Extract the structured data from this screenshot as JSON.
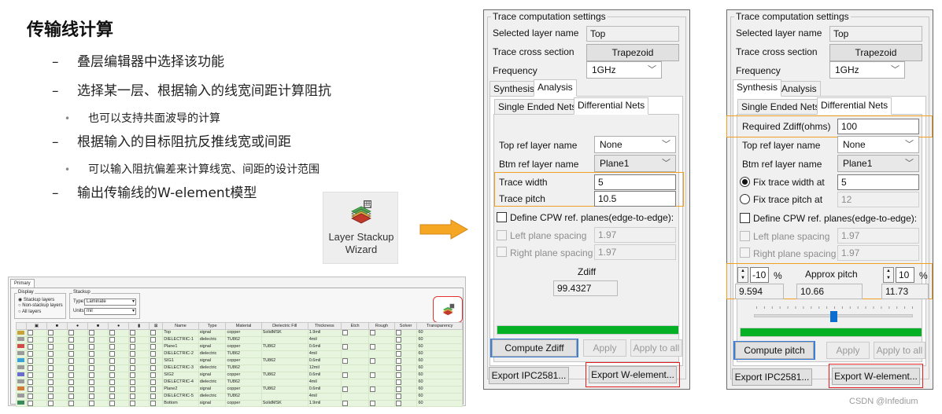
{
  "slide": {
    "title": "传输线计算",
    "bullets": [
      {
        "level": 1,
        "text": "叠层编辑器中选择该功能"
      },
      {
        "level": 1,
        "text": "选择某一层、根据输入的线宽间距计算阻抗"
      },
      {
        "level": 2,
        "text": "也可以支持共面波导的计算"
      },
      {
        "level": 1,
        "text": "根据输入的目标阻抗反推线宽或间距"
      },
      {
        "level": 2,
        "text": "可以输入阻抗偏差来计算线宽、间距的设计范围"
      },
      {
        "level": 1,
        "text": "输出传输线的W-element模型"
      }
    ],
    "wizard": {
      "icon": "layer-stackup-wizard-icon",
      "line1": "Layer Stackup",
      "line2": "Wizard"
    },
    "arrow_color": "#f5a623"
  },
  "stackup": {
    "tab": "Primary",
    "display": {
      "title": "Display",
      "options": [
        "Stackup layers",
        "Non-stackup layers",
        "All layers"
      ],
      "selected": 0
    },
    "stackup_group": {
      "title": "Stackup",
      "type_label": "Type:",
      "type_value": "Laminate",
      "units_label": "Units:",
      "units_value": "mil"
    },
    "columns": [
      "Name",
      "Type",
      "Material",
      "Dielectric Fill",
      "Thickness",
      "Etch",
      "Rough",
      "Solver",
      "Transparency"
    ],
    "rows": [
      {
        "name": "Top",
        "type": "signal",
        "material": "copper",
        "fill": "SolidMSK",
        "thickness": "1.9mil",
        "color": "#c9a13b"
      },
      {
        "name": "DIELECTRIC-1",
        "type": "dielectric",
        "material": "TU862",
        "fill": "",
        "thickness": "4mil",
        "color": "#9a9a9a"
      },
      {
        "name": "Plane1",
        "type": "signal",
        "material": "copper",
        "fill": "TU862",
        "thickness": "0.6mil",
        "color": "#d24a4a"
      },
      {
        "name": "DIELECTRIC-2",
        "type": "dielectric",
        "material": "TU862",
        "fill": "",
        "thickness": "4mil",
        "color": "#9a9a9a"
      },
      {
        "name": "SIG1",
        "type": "signal",
        "material": "copper",
        "fill": "TU862",
        "thickness": "0.6mil",
        "color": "#3aa0d8"
      },
      {
        "name": "DIELECTRIC-3",
        "type": "dielectric",
        "material": "TU862",
        "fill": "",
        "thickness": "12mil",
        "color": "#9a9a9a"
      },
      {
        "name": "SIG2",
        "type": "signal",
        "material": "copper",
        "fill": "TU862",
        "thickness": "0.6mil",
        "color": "#6a6ad0"
      },
      {
        "name": "DIELECTRIC-4",
        "type": "dielectric",
        "material": "TU862",
        "fill": "",
        "thickness": "4mil",
        "color": "#9a9a9a"
      },
      {
        "name": "Plane2",
        "type": "signal",
        "material": "copper",
        "fill": "TU862",
        "thickness": "0.6mil",
        "color": "#d27a3a"
      },
      {
        "name": "DIELECTRIC-5",
        "type": "dielectric",
        "material": "TU862",
        "fill": "",
        "thickness": "4mil",
        "color": "#9a9a9a"
      },
      {
        "name": "Bottom",
        "type": "signal",
        "material": "copper",
        "fill": "SolidMSK",
        "thickness": "1.9mil",
        "color": "#3a8a5a"
      }
    ],
    "transparency_value": "60"
  },
  "left_dialog": {
    "group_title": "Trace computation settings",
    "selected_layer_label": "Selected layer name",
    "selected_layer_value": "Top",
    "cross_section_label": "Trace cross section",
    "cross_section_value": "Trapezoid",
    "frequency_label": "Frequency",
    "frequency_value": "1GHz",
    "tabs": [
      "Synthesis",
      "Analysis"
    ],
    "active_tab": "Analysis",
    "subtabs": [
      "Single Ended Nets",
      "Differential Nets"
    ],
    "active_subtab": "Differential Nets",
    "top_ref_label": "Top ref layer name",
    "top_ref_value": "None",
    "btm_ref_label": "Btm ref layer name",
    "btm_ref_value": "Plane1",
    "trace_width_label": "Trace width",
    "trace_width_value": "5",
    "trace_pitch_label": "Trace pitch",
    "trace_pitch_value": "10.5",
    "cpw_label": "Define CPW ref. planes(edge-to-edge):",
    "left_spacing_label": "Left plane spacing",
    "left_spacing_value": "1.97",
    "right_spacing_label": "Right plane spacing",
    "right_spacing_value": "1.97",
    "zdiff_label": "Zdiff",
    "zdiff_value": "99.4327",
    "progress": 1.0,
    "compute_label": "Compute Zdiff",
    "apply_label": "Apply",
    "apply_all_label": "Apply to all",
    "export_ipc_label": "Export IPC2581...",
    "export_w_label": "Export W-element..."
  },
  "right_dialog": {
    "group_title": "Trace computation settings",
    "selected_layer_label": "Selected layer name",
    "selected_layer_value": "Top",
    "cross_section_label": "Trace cross section",
    "cross_section_value": "Trapezoid",
    "frequency_label": "Frequency",
    "frequency_value": "1GHz",
    "tabs": [
      "Synthesis",
      "Analysis"
    ],
    "active_tab": "Synthesis",
    "subtabs": [
      "Single Ended Nets",
      "Differential Nets"
    ],
    "active_subtab": "Differential Nets",
    "required_zdiff_label": "Required Zdiff(ohms)",
    "required_zdiff_value": "100",
    "top_ref_label": "Top ref layer name",
    "top_ref_value": "None",
    "btm_ref_label": "Btm ref layer name",
    "btm_ref_value": "Plane1",
    "fix_width_label": "Fix trace width at",
    "fix_width_value": "5",
    "fix_pitch_label": "Fix trace pitch at",
    "fix_pitch_value": "12",
    "cpw_label": "Define CPW ref. planes(edge-to-edge):",
    "left_spacing_label": "Left plane spacing",
    "left_spacing_value": "1.97",
    "right_spacing_label": "Right plane spacing",
    "right_spacing_value": "1.97",
    "tol_low_value": "-10",
    "tol_high_value": "10",
    "percent": "%",
    "approx_label": "Approx pitch",
    "approx_min": "9.594",
    "approx_mid": "10.66",
    "approx_max": "11.73",
    "slider_level": 0.5,
    "progress": 1.0,
    "compute_label": "Compute pitch",
    "apply_label": "Apply",
    "apply_all_label": "Apply to all",
    "export_ipc_label": "Export IPC2581...",
    "export_w_label": "Export W-element..."
  },
  "watermark": "CSDN @Infedium"
}
